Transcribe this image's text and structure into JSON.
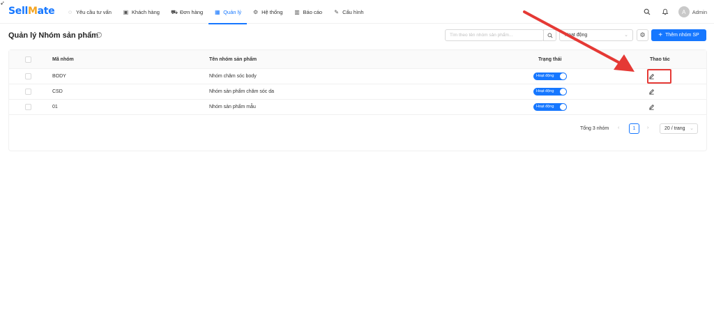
{
  "brand": {
    "part1": "Sell",
    "part2": "M",
    "part3": "ate"
  },
  "nav": [
    {
      "label": "Yêu cầu tư vấn",
      "icon": "chat-icon",
      "glyph": "◌"
    },
    {
      "label": "Khách hàng",
      "icon": "contact-card-icon",
      "glyph": "▣"
    },
    {
      "label": "Đơn hàng",
      "icon": "cart-icon",
      "glyph": "⛟"
    },
    {
      "label": "Quản lý",
      "icon": "grid-icon",
      "glyph": "▦"
    },
    {
      "label": "Hệ thống",
      "icon": "gear-icon",
      "glyph": "⚙"
    },
    {
      "label": "Báo cáo",
      "icon": "bar-chart-icon",
      "glyph": "▥"
    },
    {
      "label": "Cấu hình",
      "icon": "wrench-icon",
      "glyph": "✎"
    }
  ],
  "user": {
    "avatar_letter": "A",
    "name": "Admin"
  },
  "page": {
    "title": "Quản lý Nhóm sản phẩm"
  },
  "filters": {
    "search_placeholder": "Tìm theo tên nhóm sản phẩm...",
    "status_value": "Hoạt động",
    "add_button": "Thêm nhóm SP"
  },
  "table": {
    "headers": {
      "code": "Mã nhóm",
      "name": "Tên nhóm sản phẩm",
      "status": "Trạng thái",
      "action": "Thao tác"
    },
    "rows": [
      {
        "code": "BODY",
        "name": "Nhóm chăm sóc body",
        "status": "Hoạt động"
      },
      {
        "code": "CSD",
        "name": "Nhóm sản phẩm chăm sóc da",
        "status": "Hoạt động"
      },
      {
        "code": "01",
        "name": "Nhóm sản phẩm mẫu",
        "status": "Hoạt động"
      }
    ]
  },
  "pagination": {
    "total": "Tổng 3 nhóm",
    "current_page": "1",
    "page_size": "20 / trang"
  },
  "colors": {
    "primary": "#1677ff",
    "annotation": "#e53935"
  }
}
